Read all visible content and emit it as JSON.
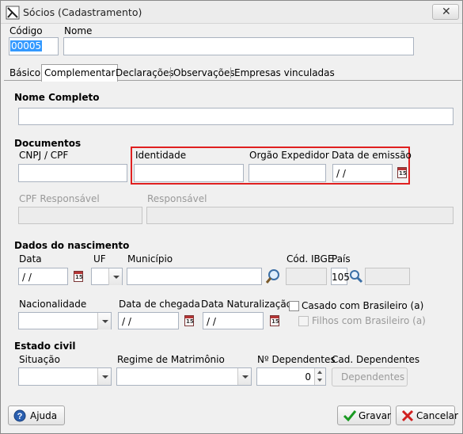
{
  "window": {
    "title": "Sócios (Cadastramento)",
    "close_glyph": "✕",
    "accent_highlight": "#e02020"
  },
  "header": {
    "codigo_label": "Código",
    "codigo_value": "00005",
    "nome_label": "Nome",
    "nome_value": ""
  },
  "tabs": [
    {
      "label": "Básico",
      "active": false
    },
    {
      "label": "Complementar",
      "active": true
    },
    {
      "label": "Declarações",
      "active": false
    },
    {
      "label": "Observações",
      "active": false
    },
    {
      "label": "Empresas vinculadas",
      "active": false
    }
  ],
  "nome_completo": {
    "label": "Nome Completo",
    "value": ""
  },
  "documentos": {
    "section_label": "Documentos",
    "cnpj_cpf_label": "CNPJ / CPF",
    "identidade_label": "Identidade",
    "orgao_label": "Orgão Expedidor",
    "data_emissao_label": "Data de emissão",
    "data_emissao_value": " / /",
    "cpf_responsavel_label": "CPF Responsável",
    "responsavel_label": "Responsável"
  },
  "nascimento": {
    "section_label": "Dados do nascimento",
    "data_label": "Data",
    "data_value": " / /",
    "uf_label": "UF",
    "municipio_label": "Município",
    "cod_ibge_label": "Cód. IBGE",
    "pais_label": "País",
    "pais_value": "105",
    "nacionalidade_label": "Nacionalidade",
    "data_chegada_label": "Data de chegada",
    "data_chegada_value": " / /",
    "data_naturalizacao_label": "Data Naturalização",
    "data_naturalizacao_value": " / /",
    "casado_label": "Casado com Brasileiro (a)",
    "filhos_label": "Filhos com Brasileiro (a)"
  },
  "estado_civil": {
    "section_label": "Estado civil",
    "situacao_label": "Situação",
    "regime_label": "Regime de Matrimônio",
    "n_dependentes_label": "Nº Dependentes",
    "n_dependentes_value": "0",
    "cad_dependentes_label": "Cad. Dependentes",
    "dependentes_button": "Dependentes"
  },
  "footer": {
    "ajuda_label": "Ajuda",
    "gravar_label": "Gravar",
    "cancelar_label": "Cancelar"
  },
  "icons": {
    "calendar": "calendar-icon",
    "search": "search-icon",
    "help": "help-icon",
    "check": "check-icon",
    "cancel": "cancel-icon"
  }
}
